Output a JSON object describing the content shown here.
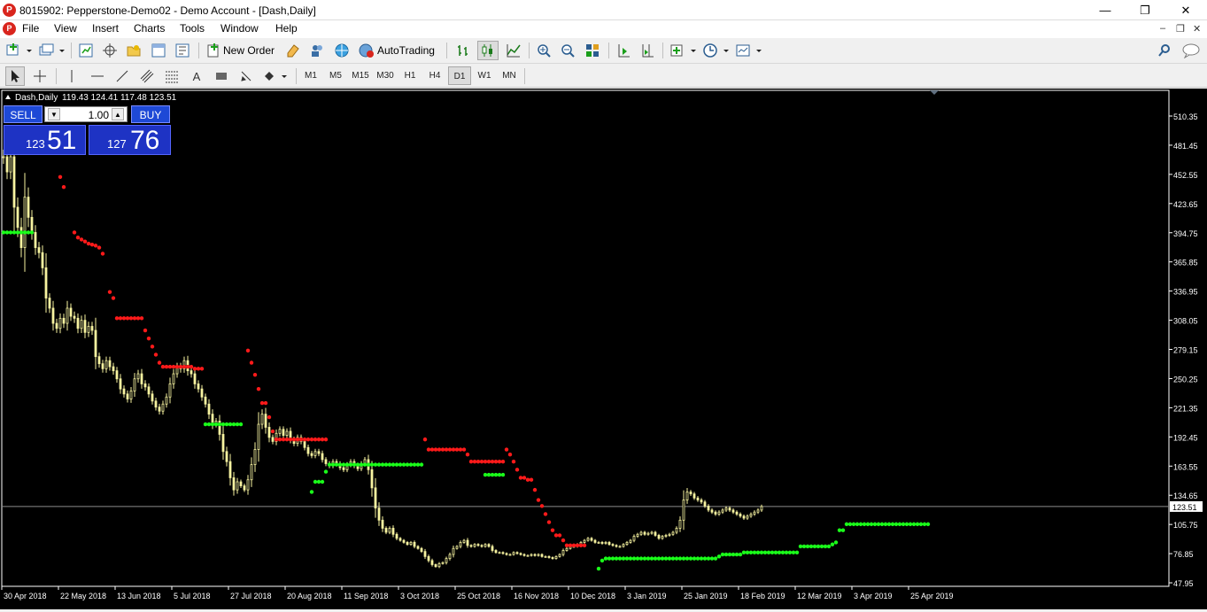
{
  "window": {
    "title": "8015902: Pepperstone-Demo02 - Demo Account - [Dash,Daily]",
    "app_icon": "P"
  },
  "menu": [
    "File",
    "View",
    "Insert",
    "Charts",
    "Tools",
    "Window",
    "Help"
  ],
  "toolbar": {
    "new_order_label": "New Order",
    "autotrading_label": "AutoTrading"
  },
  "timeframes": [
    "M1",
    "M5",
    "M15",
    "M30",
    "H1",
    "H4",
    "D1",
    "W1",
    "MN"
  ],
  "active_timeframe": "D1",
  "chart": {
    "header": "Dash,Daily",
    "ohlc": "119.43 124.41 117.48 123.51",
    "current_price": "123.51",
    "colors": {
      "background": "#000000",
      "candle": "#f7f3a0",
      "sar_down": "#ff1a1a",
      "sar_up": "#1aff1a",
      "price_line": "#8c8c8c"
    }
  },
  "trade_panel": {
    "sell_label": "SELL",
    "buy_label": "BUY",
    "lot": "1.00",
    "sell_price_small": "123",
    "sell_price_big": "51",
    "buy_price_small": "127",
    "buy_price_big": "76"
  },
  "chart_data": {
    "type": "candlestick",
    "symbol": "Dash",
    "period": "Daily",
    "ylim": [
      47.95,
      530
    ],
    "y_ticks": [
      "510.35",
      "481.45",
      "452.55",
      "423.65",
      "394.75",
      "365.85",
      "336.95",
      "308.05",
      "279.15",
      "250.25",
      "221.35",
      "192.45",
      "163.55",
      "134.65",
      "105.75",
      "76.85",
      "47.95"
    ],
    "x_ticks": [
      "30 Apr 2018",
      "22 May 2018",
      "13 Jun 2018",
      "5 Jul 2018",
      "27 Jul 2018",
      "20 Aug 2018",
      "11 Sep 2018",
      "3 Oct 2018",
      "25 Oct 2018",
      "16 Nov 2018",
      "10 Dec 2018",
      "3 Jan 2019",
      "25 Jan 2019",
      "18 Feb 2019",
      "12 Mar 2019",
      "3 Apr 2019",
      "25 Apr 2019"
    ],
    "x_tick_index": [
      0,
      16,
      32,
      48,
      64,
      80,
      96,
      112,
      128,
      144,
      160,
      176,
      192,
      208,
      224,
      240,
      256
    ],
    "close": [
      470,
      455,
      470,
      420,
      400,
      380,
      430,
      410,
      395,
      380,
      375,
      360,
      330,
      320,
      305,
      300,
      310,
      305,
      320,
      312,
      310,
      300,
      308,
      296,
      302,
      298,
      272,
      265,
      260,
      268,
      262,
      258,
      250,
      240,
      235,
      230,
      238,
      250,
      255,
      245,
      242,
      235,
      228,
      222,
      218,
      225,
      232,
      245,
      255,
      262,
      260,
      268,
      258,
      255,
      245,
      240,
      232,
      225,
      215,
      205,
      208,
      195,
      178,
      168,
      152,
      140,
      148,
      144,
      140,
      150,
      165,
      180,
      205,
      215,
      202,
      192,
      188,
      196,
      200,
      194,
      198,
      190,
      186,
      192,
      188,
      182,
      176,
      174,
      178,
      176,
      170,
      166,
      164,
      168,
      166,
      162,
      160,
      165,
      168,
      164,
      161,
      166,
      170,
      160,
      142,
      122,
      110,
      102,
      98,
      102,
      96,
      92,
      90,
      88,
      86,
      88,
      84,
      82,
      79,
      74,
      70,
      66,
      64,
      67,
      68,
      72,
      76,
      82,
      84,
      88,
      90,
      85,
      84,
      86,
      85,
      84,
      86,
      84,
      80,
      78,
      78,
      77,
      76,
      76,
      78,
      77,
      76,
      75,
      75,
      76,
      75,
      76,
      74,
      74,
      73,
      72,
      74,
      76,
      80,
      82,
      84,
      84,
      86,
      88,
      90,
      92,
      90,
      88,
      88,
      87,
      88,
      86,
      85,
      84,
      84,
      86,
      88,
      90,
      94,
      96,
      98,
      96,
      97,
      98,
      95,
      92,
      94,
      95,
      96,
      98,
      102,
      110,
      130,
      138,
      136,
      132,
      130,
      128,
      124,
      120,
      118,
      116,
      118,
      120,
      122,
      120,
      118,
      116,
      114,
      112,
      114,
      116,
      118,
      120,
      123.51
    ],
    "sar_down": [
      [
        0,
        0
      ],
      [
        16,
        450
      ],
      [
        17,
        440
      ],
      [
        20,
        395
      ],
      [
        21,
        390
      ],
      [
        22,
        388
      ],
      [
        23,
        386
      ],
      [
        24,
        384
      ],
      [
        25,
        383
      ],
      [
        26,
        382
      ],
      [
        27,
        380
      ],
      [
        28,
        374
      ],
      [
        30,
        336
      ],
      [
        31,
        330
      ],
      [
        32,
        310
      ],
      [
        33,
        310
      ],
      [
        34,
        310
      ],
      [
        35,
        310
      ],
      [
        36,
        310
      ],
      [
        37,
        310
      ],
      [
        38,
        310
      ],
      [
        39,
        310
      ],
      [
        40,
        298
      ],
      [
        41,
        290
      ],
      [
        42,
        282
      ],
      [
        43,
        274
      ],
      [
        44,
        266
      ],
      [
        45,
        262
      ],
      [
        46,
        262
      ],
      [
        47,
        262
      ],
      [
        48,
        262
      ],
      [
        49,
        262
      ],
      [
        50,
        262
      ],
      [
        51,
        262
      ],
      [
        52,
        262
      ],
      [
        53,
        262
      ],
      [
        54,
        260
      ],
      [
        55,
        260
      ],
      [
        56,
        260
      ],
      [
        69,
        278
      ],
      [
        70,
        266
      ],
      [
        71,
        254
      ],
      [
        72,
        240
      ],
      [
        73,
        226
      ],
      [
        74,
        226
      ],
      [
        75,
        212
      ],
      [
        76,
        198
      ],
      [
        77,
        190
      ],
      [
        78,
        190
      ],
      [
        79,
        190
      ],
      [
        80,
        190
      ],
      [
        81,
        190
      ],
      [
        82,
        190
      ],
      [
        83,
        190
      ],
      [
        84,
        190
      ],
      [
        85,
        190
      ],
      [
        86,
        190
      ],
      [
        87,
        190
      ],
      [
        88,
        190
      ],
      [
        89,
        190
      ],
      [
        90,
        190
      ],
      [
        91,
        190
      ],
      [
        119,
        190
      ],
      [
        120,
        180
      ],
      [
        121,
        180
      ],
      [
        122,
        180
      ],
      [
        123,
        180
      ],
      [
        124,
        180
      ],
      [
        125,
        180
      ],
      [
        126,
        180
      ],
      [
        127,
        180
      ],
      [
        128,
        180
      ],
      [
        129,
        180
      ],
      [
        130,
        180
      ],
      [
        131,
        175
      ],
      [
        132,
        168
      ],
      [
        133,
        168
      ],
      [
        134,
        168
      ],
      [
        135,
        168
      ],
      [
        136,
        168
      ],
      [
        137,
        168
      ],
      [
        138,
        168
      ],
      [
        139,
        168
      ],
      [
        140,
        168
      ],
      [
        141,
        168
      ],
      [
        142,
        180
      ],
      [
        143,
        175
      ],
      [
        144,
        168
      ],
      [
        145,
        160
      ],
      [
        146,
        152
      ],
      [
        147,
        152
      ],
      [
        148,
        150
      ],
      [
        149,
        150
      ],
      [
        150,
        140
      ],
      [
        151,
        130
      ],
      [
        152,
        124
      ],
      [
        153,
        116
      ],
      [
        154,
        108
      ],
      [
        155,
        100
      ],
      [
        156,
        95
      ],
      [
        157,
        95
      ],
      [
        158,
        90
      ],
      [
        159,
        85
      ],
      [
        160,
        85
      ],
      [
        161,
        85
      ],
      [
        162,
        85
      ],
      [
        163,
        85
      ],
      [
        164,
        85
      ]
    ],
    "sar_up": [
      [
        0,
        395
      ],
      [
        1,
        395
      ],
      [
        2,
        395
      ],
      [
        3,
        395
      ],
      [
        4,
        395
      ],
      [
        5,
        395
      ],
      [
        6,
        395
      ],
      [
        7,
        395
      ],
      [
        8,
        395
      ],
      [
        57,
        205
      ],
      [
        58,
        205
      ],
      [
        59,
        205
      ],
      [
        60,
        205
      ],
      [
        61,
        205
      ],
      [
        62,
        205
      ],
      [
        63,
        205
      ],
      [
        64,
        205
      ],
      [
        65,
        205
      ],
      [
        66,
        205
      ],
      [
        67,
        205
      ],
      [
        87,
        138
      ],
      [
        88,
        148
      ],
      [
        89,
        148
      ],
      [
        90,
        148
      ],
      [
        91,
        158
      ],
      [
        92,
        165
      ],
      [
        93,
        165
      ],
      [
        94,
        165
      ],
      [
        95,
        165
      ],
      [
        96,
        165
      ],
      [
        97,
        165
      ],
      [
        98,
        165
      ],
      [
        99,
        165
      ],
      [
        100,
        165
      ],
      [
        101,
        165
      ],
      [
        102,
        165
      ],
      [
        103,
        165
      ],
      [
        104,
        165
      ],
      [
        105,
        165
      ],
      [
        106,
        165
      ],
      [
        107,
        165
      ],
      [
        108,
        165
      ],
      [
        109,
        165
      ],
      [
        110,
        165
      ],
      [
        111,
        165
      ],
      [
        112,
        165
      ],
      [
        113,
        165
      ],
      [
        114,
        165
      ],
      [
        115,
        165
      ],
      [
        116,
        165
      ],
      [
        117,
        165
      ],
      [
        118,
        165
      ],
      [
        136,
        155
      ],
      [
        137,
        155
      ],
      [
        138,
        155
      ],
      [
        139,
        155
      ],
      [
        140,
        155
      ],
      [
        141,
        155
      ],
      [
        168,
        62
      ],
      [
        169,
        70
      ],
      [
        170,
        72
      ],
      [
        171,
        72
      ],
      [
        172,
        72
      ],
      [
        173,
        72
      ],
      [
        174,
        72
      ],
      [
        175,
        72
      ],
      [
        176,
        72
      ],
      [
        177,
        72
      ],
      [
        178,
        72
      ],
      [
        179,
        72
      ],
      [
        180,
        72
      ],
      [
        181,
        72
      ],
      [
        182,
        72
      ],
      [
        183,
        72
      ],
      [
        184,
        72
      ],
      [
        185,
        72
      ],
      [
        186,
        72
      ],
      [
        187,
        72
      ],
      [
        188,
        72
      ],
      [
        189,
        72
      ],
      [
        190,
        72
      ],
      [
        191,
        72
      ],
      [
        192,
        72
      ],
      [
        193,
        72
      ],
      [
        194,
        72
      ],
      [
        195,
        72
      ],
      [
        196,
        72
      ],
      [
        197,
        72
      ],
      [
        198,
        72
      ],
      [
        199,
        72
      ],
      [
        200,
        72
      ],
      [
        201,
        72
      ],
      [
        202,
        74
      ],
      [
        203,
        76
      ],
      [
        204,
        76
      ],
      [
        205,
        76
      ],
      [
        206,
        76
      ],
      [
        207,
        76
      ],
      [
        208,
        76
      ],
      [
        209,
        78
      ],
      [
        210,
        78
      ],
      [
        211,
        78
      ],
      [
        212,
        78
      ],
      [
        213,
        78
      ],
      [
        214,
        78
      ],
      [
        215,
        78
      ],
      [
        216,
        78
      ],
      [
        217,
        78
      ],
      [
        218,
        78
      ],
      [
        219,
        78
      ],
      [
        220,
        78
      ],
      [
        221,
        78
      ],
      [
        222,
        78
      ],
      [
        223,
        78
      ],
      [
        224,
        78
      ],
      [
        225,
        84
      ],
      [
        226,
        84
      ],
      [
        227,
        84
      ],
      [
        228,
        84
      ],
      [
        229,
        84
      ],
      [
        230,
        84
      ],
      [
        231,
        84
      ],
      [
        232,
        84
      ],
      [
        233,
        84
      ],
      [
        234,
        86
      ],
      [
        235,
        88
      ],
      [
        236,
        100
      ],
      [
        237,
        100
      ],
      [
        238,
        106
      ],
      [
        239,
        106
      ],
      [
        240,
        106
      ],
      [
        241,
        106
      ],
      [
        242,
        106
      ],
      [
        243,
        106
      ],
      [
        244,
        106
      ],
      [
        245,
        106
      ],
      [
        246,
        106
      ],
      [
        247,
        106
      ],
      [
        248,
        106
      ],
      [
        249,
        106
      ],
      [
        250,
        106
      ],
      [
        251,
        106
      ],
      [
        252,
        106
      ],
      [
        253,
        106
      ],
      [
        254,
        106
      ],
      [
        255,
        106
      ],
      [
        256,
        106
      ],
      [
        257,
        106
      ],
      [
        258,
        106
      ],
      [
        259,
        106
      ],
      [
        260,
        106
      ],
      [
        261,
        106
      ]
    ]
  }
}
